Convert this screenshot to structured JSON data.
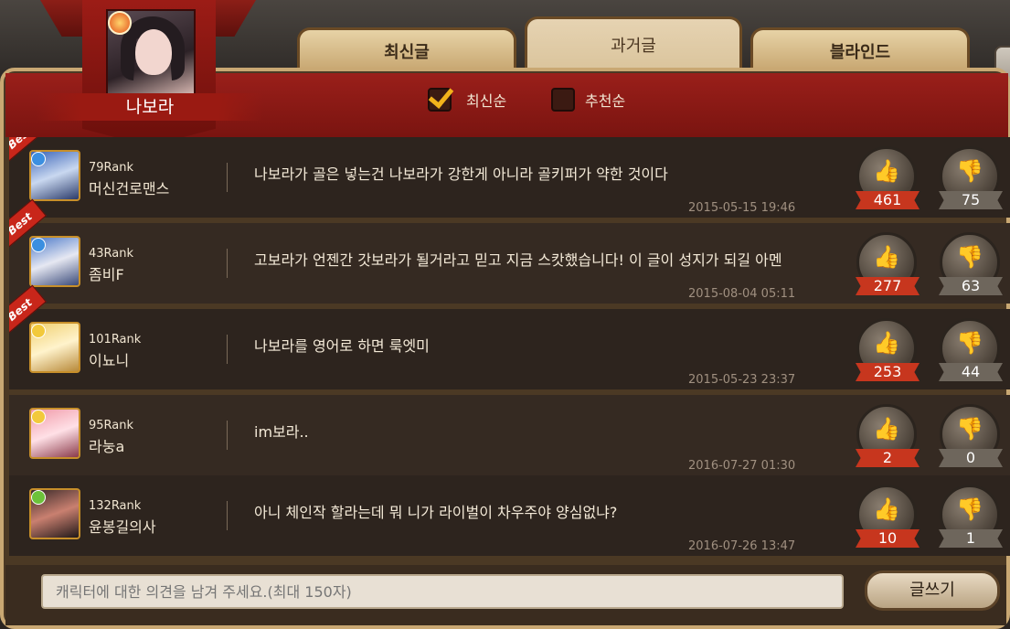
{
  "tabs": [
    {
      "label": "최신글",
      "active": false
    },
    {
      "label": "과거글",
      "active": true
    },
    {
      "label": "블라인드",
      "active": false
    }
  ],
  "character": {
    "name": "나보라"
  },
  "sort": {
    "latest": {
      "label": "최신순",
      "checked": true
    },
    "recommended": {
      "label": "추천순",
      "checked": false
    }
  },
  "colors": {
    "accent_red": "#9a1f1a",
    "gold": "#c9a873",
    "like_red": "#c7361e"
  },
  "comments": [
    {
      "best": "Best",
      "rank": "79Rank",
      "user": "머신건로맨스",
      "text": "나보라가 골은 넣는건 나보라가 강한게 아니라 골키퍼가 약한 것이다",
      "date": "2015-05-15 19:46",
      "likes": "461",
      "dislikes": "75",
      "element": "water-icon"
    },
    {
      "best": "Best",
      "rank": "43Rank",
      "user": "좀비F",
      "text": "고보라가 언젠간 갓보라가 될거라고 믿고 지금 스캇했습니다! 이 글이 성지가 되길 아멘",
      "date": "2015-08-04 05:11",
      "likes": "277",
      "dislikes": "63",
      "element": "water-icon"
    },
    {
      "best": "Best",
      "rank": "101Rank",
      "user": "이뇨니",
      "text": "나보라를 영어로 하면 룩엣미",
      "date": "2015-05-23 23:37",
      "likes": "253",
      "dislikes": "44",
      "element": "light-icon"
    },
    {
      "best": "",
      "rank": "95Rank",
      "user": "라눙a",
      "text": "im보라..",
      "date": "2016-07-27 01:30",
      "likes": "2",
      "dislikes": "0",
      "element": "light-icon"
    },
    {
      "best": "",
      "rank": "132Rank",
      "user": "윤봉길의사",
      "text": "아니 체인작 할라는데 뭐 니가 라이벌이 차우주야 양심없냐?",
      "date": "2016-07-26 13:47",
      "likes": "10",
      "dislikes": "1",
      "element": "earth-icon"
    }
  ],
  "footer": {
    "placeholder": "캐릭터에 대한 의견을 남겨 주세요.(최대 150자)",
    "write_label": "글쓰기"
  }
}
